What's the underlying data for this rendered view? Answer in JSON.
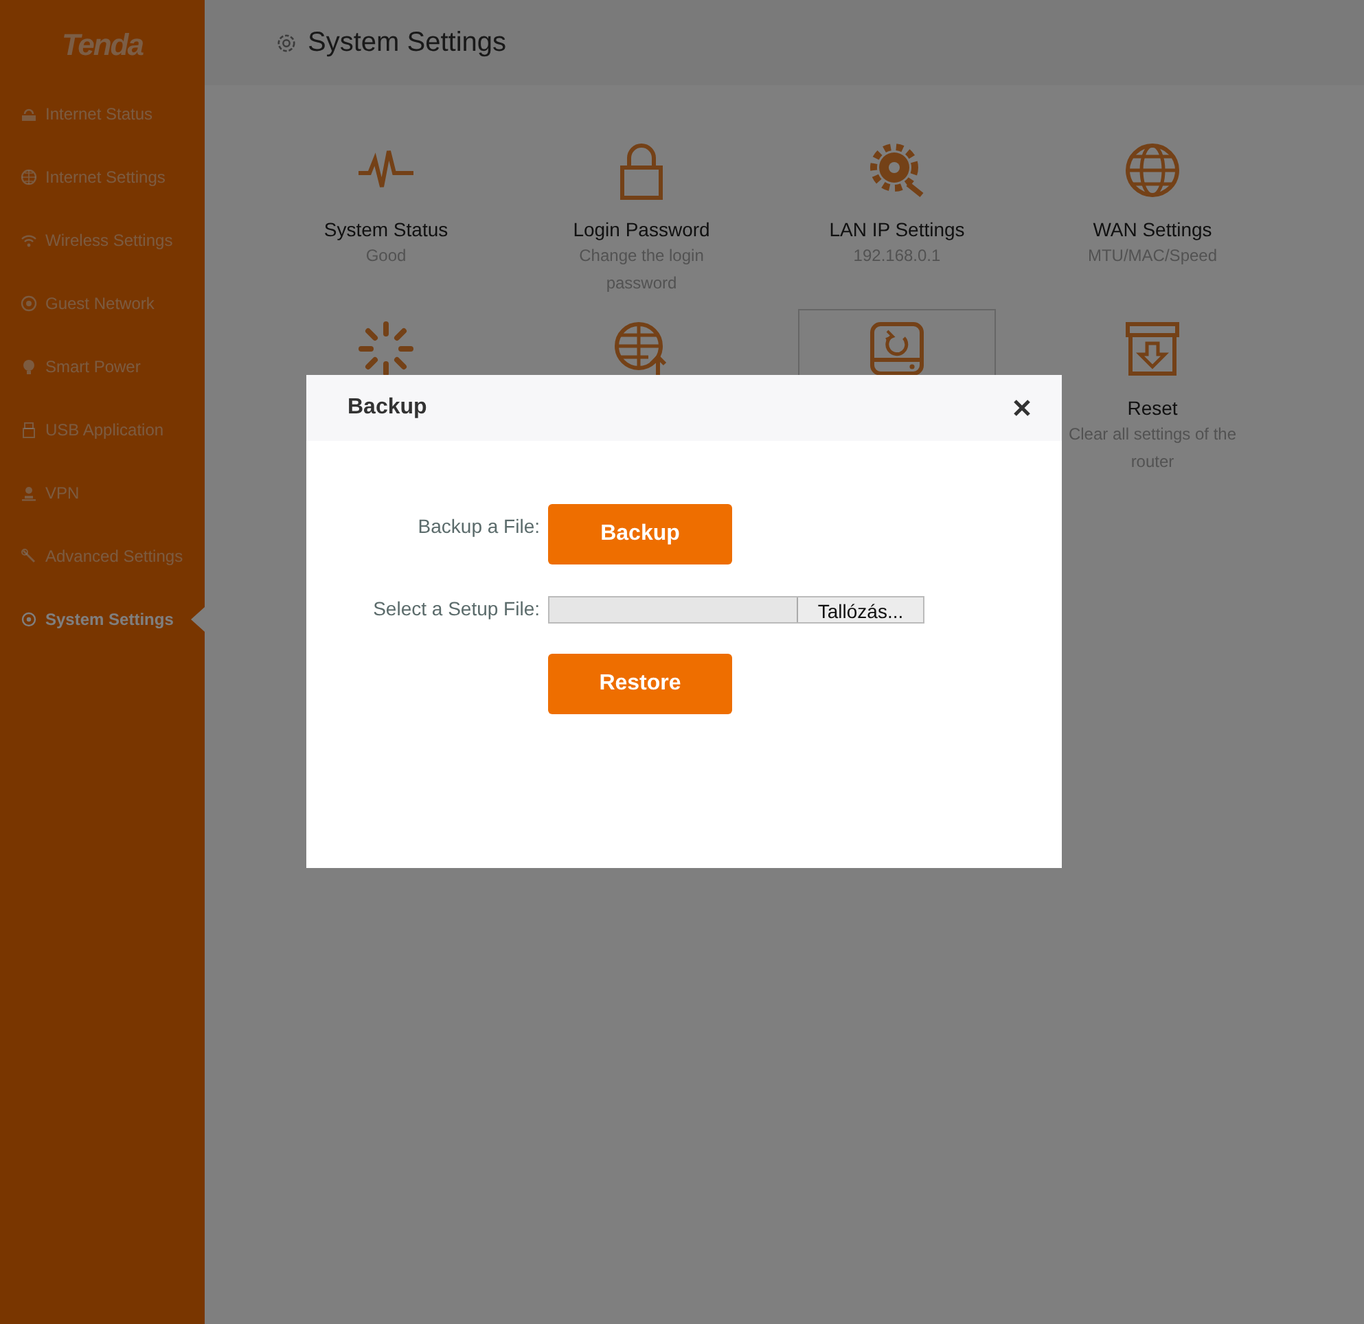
{
  "sidebar": {
    "logo": "Tenda",
    "items": [
      {
        "label": "Internet Status",
        "selected": false
      },
      {
        "label": "Internet Settings",
        "selected": false
      },
      {
        "label": "Wireless Settings",
        "selected": false
      },
      {
        "label": "Guest Network",
        "selected": false
      },
      {
        "label": "Smart Power",
        "selected": false
      },
      {
        "label": "USB Application",
        "selected": false
      },
      {
        "label": "VPN",
        "selected": false
      },
      {
        "label": "Advanced Settings",
        "selected": false
      },
      {
        "label": "System Settings",
        "selected": true
      }
    ]
  },
  "page": {
    "title": "System Settings"
  },
  "tiles": [
    {
      "title": "System Status",
      "subtitle": "Good",
      "selected": false
    },
    {
      "title": "Login Password",
      "subtitle": "Change the login password",
      "selected": false
    },
    {
      "title": "LAN IP Settings",
      "subtitle": "192.168.0.1",
      "selected": false
    },
    {
      "title": "WAN Settings",
      "subtitle": "MTU/MAC/Speed",
      "selected": false
    },
    {
      "selected": false
    },
    {
      "selected": false
    },
    {
      "selected": true
    },
    {
      "title": "Reset",
      "subtitle": "Clear all settings of the router",
      "selected": false
    }
  ],
  "dialog": {
    "title": "Backup",
    "rows": [
      {
        "kind": "button",
        "label": "Backup a File:",
        "button": "Backup"
      },
      {
        "kind": "file",
        "label": "Select a Setup File:",
        "browse": "Tallózás..."
      },
      {
        "kind": "button",
        "button": "Restore"
      }
    ]
  }
}
